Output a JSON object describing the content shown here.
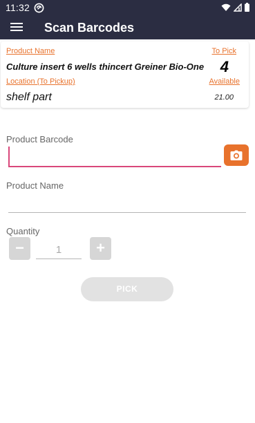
{
  "status_bar": {
    "time": "11:32"
  },
  "app_bar": {
    "title": "Scan Barcodes"
  },
  "card": {
    "product_name_label": "Product Name",
    "product_name": "Culture insert 6 wells thincert Greiner Bio-One",
    "to_pick_label": "To Pick",
    "to_pick": "4",
    "location_label": "Location (To Pickup)",
    "location": "shelf part",
    "available_label": "Available",
    "available": "21.00"
  },
  "form": {
    "barcode_label": "Product Barcode",
    "barcode_value": "",
    "product_name_label": "Product Name",
    "product_name_value": "",
    "quantity_label": "Quantity",
    "quantity_value": "1",
    "decrement_label": "−",
    "increment_label": "+",
    "pick_label": "PICK"
  },
  "colors": {
    "app_bar": "#2b2d42",
    "accent": "#e8722c",
    "focus_underline": "#d9477a",
    "disabled": "#d6d6d6"
  },
  "icons": [
    "menu-icon",
    "camera-icon",
    "wifi-icon",
    "signal-icon",
    "battery-icon",
    "app-notification-icon"
  ]
}
